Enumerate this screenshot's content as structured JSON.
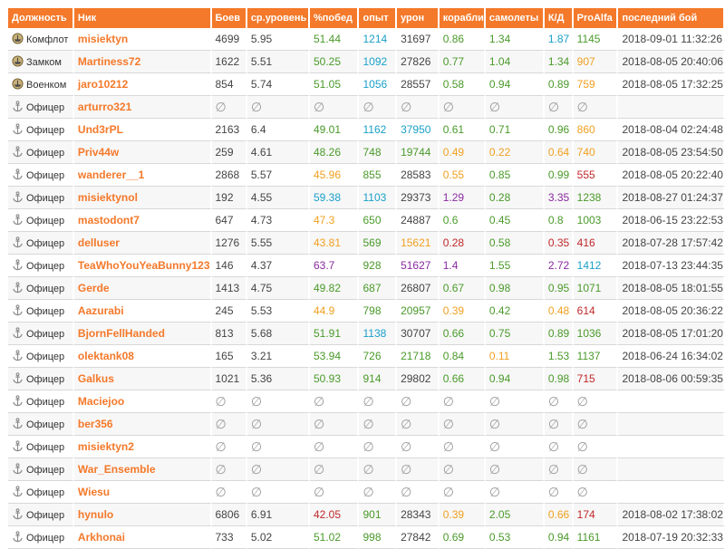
{
  "headers": [
    "Должность",
    "Ник",
    "Боев",
    "ср.уровень",
    "%побед",
    "опыт",
    "урон",
    "корабли",
    "самолеты",
    "К/Д",
    "ProAlfa",
    "последний бой"
  ],
  "empty_symbol": "∅",
  "rows": [
    {
      "role": "Комфлот",
      "icon": "ship-medal-icon",
      "nick": "misiektyn",
      "battles": "4699",
      "level": "5.95",
      "win": "51.44",
      "winc": "g",
      "xp": "1214",
      "xpc": "c",
      "dmg": "31697",
      "dmgc": "d",
      "ships": "0.86",
      "shipsc": "g",
      "planes": "1.34",
      "planesc": "g",
      "kd": "1.87",
      "kdc": "c",
      "pa": "1145",
      "pac": "g",
      "last": "2018-09-01 11:32:26"
    },
    {
      "role": "Замком",
      "icon": "ship-medal-icon",
      "nick": "Martiness72",
      "battles": "1622",
      "level": "5.51",
      "win": "50.25",
      "winc": "g",
      "xp": "1092",
      "xpc": "c",
      "dmg": "27826",
      "dmgc": "d",
      "ships": "0.77",
      "shipsc": "g",
      "planes": "1.04",
      "planesc": "g",
      "kd": "1.34",
      "kdc": "g",
      "pa": "907",
      "pac": "o",
      "last": "2018-08-05 20:40:06"
    },
    {
      "role": "Военком",
      "icon": "ship-medal-icon",
      "nick": "jaro10212",
      "battles": "854",
      "level": "5.74",
      "win": "51.05",
      "winc": "g",
      "xp": "1056",
      "xpc": "c",
      "dmg": "28557",
      "dmgc": "d",
      "ships": "0.58",
      "shipsc": "g",
      "planes": "0.94",
      "planesc": "g",
      "kd": "0.89",
      "kdc": "g",
      "pa": "759",
      "pac": "o",
      "last": "2018-08-05 17:32:25"
    },
    {
      "role": "Офицер",
      "icon": "anchor-icon",
      "nick": "arturro321",
      "empty": true
    },
    {
      "role": "Офицер",
      "icon": "anchor-icon",
      "nick": "Und3rPL",
      "battles": "2163",
      "level": "6.4",
      "win": "49.01",
      "winc": "g",
      "xp": "1162",
      "xpc": "c",
      "dmg": "37950",
      "dmgc": "c",
      "ships": "0.61",
      "shipsc": "g",
      "planes": "0.71",
      "planesc": "g",
      "kd": "0.96",
      "kdc": "g",
      "pa": "860",
      "pac": "o",
      "last": "2018-08-04 02:24:48"
    },
    {
      "role": "Офицер",
      "icon": "anchor-icon",
      "nick": "Priv44w",
      "battles": "259",
      "level": "4.61",
      "win": "48.26",
      "winc": "g",
      "xp": "748",
      "xpc": "g",
      "dmg": "19744",
      "dmgc": "g",
      "ships": "0.49",
      "shipsc": "o",
      "planes": "0.22",
      "planesc": "o",
      "kd": "0.64",
      "kdc": "o",
      "pa": "740",
      "pac": "o",
      "last": "2018-08-05 23:54:50"
    },
    {
      "role": "Офицер",
      "icon": "anchor-icon",
      "nick": "wanderer__1",
      "battles": "2868",
      "level": "5.57",
      "win": "45.96",
      "winc": "o",
      "xp": "855",
      "xpc": "g",
      "dmg": "28583",
      "dmgc": "d",
      "ships": "0.55",
      "shipsc": "o",
      "planes": "0.85",
      "planesc": "g",
      "kd": "0.99",
      "kdc": "g",
      "pa": "555",
      "pac": "r",
      "last": "2018-08-05 20:22:40"
    },
    {
      "role": "Офицер",
      "icon": "anchor-icon",
      "nick": "misiektynol",
      "battles": "192",
      "level": "4.55",
      "win": "59.38",
      "winc": "c",
      "xp": "1103",
      "xpc": "c",
      "dmg": "29373",
      "dmgc": "d",
      "ships": "1.29",
      "shipsc": "p",
      "planes": "0.28",
      "planesc": "g",
      "kd": "3.35",
      "kdc": "p",
      "pa": "1238",
      "pac": "g",
      "last": "2018-08-27 01:24:37"
    },
    {
      "role": "Офицер",
      "icon": "anchor-icon",
      "nick": "mastodont7",
      "battles": "647",
      "level": "4.73",
      "win": "47.3",
      "winc": "o",
      "xp": "650",
      "xpc": "g",
      "dmg": "24887",
      "dmgc": "d",
      "ships": "0.6",
      "shipsc": "g",
      "planes": "0.45",
      "planesc": "g",
      "kd": "0.8",
      "kdc": "g",
      "pa": "1003",
      "pac": "g",
      "last": "2018-06-15 23:22:53"
    },
    {
      "role": "Офицер",
      "icon": "anchor-icon",
      "nick": "delluser",
      "battles": "1276",
      "level": "5.55",
      "win": "43.81",
      "winc": "o",
      "xp": "569",
      "xpc": "g",
      "dmg": "15621",
      "dmgc": "o",
      "ships": "0.28",
      "shipsc": "r",
      "planes": "0.58",
      "planesc": "g",
      "kd": "0.35",
      "kdc": "r",
      "pa": "416",
      "pac": "r",
      "last": "2018-07-28 17:57:42"
    },
    {
      "role": "Офицер",
      "icon": "anchor-icon",
      "nick": "TeaWhoYouYeaBunny123",
      "battles": "146",
      "level": "4.37",
      "win": "63.7",
      "winc": "p",
      "xp": "928",
      "xpc": "g",
      "dmg": "51627",
      "dmgc": "p",
      "ships": "1.4",
      "shipsc": "p",
      "planes": "1.55",
      "planesc": "g",
      "kd": "2.72",
      "kdc": "p",
      "pa": "1412",
      "pac": "c",
      "last": "2018-07-13 23:44:35"
    },
    {
      "role": "Офицер",
      "icon": "anchor-icon",
      "nick": "Gerde",
      "battles": "1413",
      "level": "4.75",
      "win": "49.82",
      "winc": "g",
      "xp": "687",
      "xpc": "g",
      "dmg": "26807",
      "dmgc": "d",
      "ships": "0.67",
      "shipsc": "g",
      "planes": "0.98",
      "planesc": "g",
      "kd": "0.95",
      "kdc": "g",
      "pa": "1071",
      "pac": "g",
      "last": "2018-08-05 18:01:55"
    },
    {
      "role": "Офицер",
      "icon": "anchor-icon",
      "nick": "Aazurabi",
      "battles": "245",
      "level": "5.53",
      "win": "44.9",
      "winc": "o",
      "xp": "798",
      "xpc": "g",
      "dmg": "20957",
      "dmgc": "g",
      "ships": "0.39",
      "shipsc": "o",
      "planes": "0.42",
      "planesc": "g",
      "kd": "0.48",
      "kdc": "o",
      "pa": "614",
      "pac": "r",
      "last": "2018-08-05 20:36:22"
    },
    {
      "role": "Офицер",
      "icon": "anchor-icon",
      "nick": "BjornFellHanded",
      "battles": "813",
      "level": "5.68",
      "win": "51.91",
      "winc": "g",
      "xp": "1138",
      "xpc": "c",
      "dmg": "30707",
      "dmgc": "d",
      "ships": "0.66",
      "shipsc": "g",
      "planes": "0.75",
      "planesc": "g",
      "kd": "0.89",
      "kdc": "g",
      "pa": "1036",
      "pac": "g",
      "last": "2018-08-05 17:01:20"
    },
    {
      "role": "Офицер",
      "icon": "anchor-icon",
      "nick": "olektank08",
      "battles": "165",
      "level": "3.21",
      "win": "53.94",
      "winc": "g",
      "xp": "726",
      "xpc": "g",
      "dmg": "21718",
      "dmgc": "g",
      "ships": "0.84",
      "shipsc": "g",
      "planes": "0.11",
      "planesc": "o",
      "kd": "1.53",
      "kdc": "g",
      "pa": "1137",
      "pac": "g",
      "last": "2018-06-24 16:34:02"
    },
    {
      "role": "Офицер",
      "icon": "anchor-icon",
      "nick": "Galkus",
      "battles": "1021",
      "level": "5.36",
      "win": "50.93",
      "winc": "g",
      "xp": "914",
      "xpc": "g",
      "dmg": "29802",
      "dmgc": "d",
      "ships": "0.66",
      "shipsc": "g",
      "planes": "0.94",
      "planesc": "g",
      "kd": "0.98",
      "kdc": "g",
      "pa": "715",
      "pac": "r",
      "last": "2018-08-06 00:59:35"
    },
    {
      "role": "Офицер",
      "icon": "anchor-icon",
      "nick": "Maciejoo",
      "empty": true
    },
    {
      "role": "Офицер",
      "icon": "anchor-icon",
      "nick": "ber356",
      "empty": true
    },
    {
      "role": "Офицер",
      "icon": "anchor-icon",
      "nick": "misiektyn2",
      "empty": true
    },
    {
      "role": "Офицер",
      "icon": "anchor-icon",
      "nick": "War_Ensemble",
      "empty": true
    },
    {
      "role": "Офицер",
      "icon": "anchor-icon",
      "nick": "Wiesu",
      "empty": true
    },
    {
      "role": "Офицер",
      "icon": "anchor-icon",
      "nick": "hynulo",
      "battles": "6806",
      "level": "6.91",
      "win": "42.05",
      "winc": "r",
      "xp": "901",
      "xpc": "g",
      "dmg": "28343",
      "dmgc": "d",
      "ships": "0.39",
      "shipsc": "o",
      "planes": "2.05",
      "planesc": "g",
      "kd": "0.66",
      "kdc": "o",
      "pa": "174",
      "pac": "r",
      "last": "2018-08-02 17:38:02"
    },
    {
      "role": "Офицер",
      "icon": "anchor-icon",
      "nick": "Arkhonai",
      "battles": "733",
      "level": "5.02",
      "win": "51.02",
      "winc": "g",
      "xp": "998",
      "xpc": "g",
      "dmg": "27842",
      "dmgc": "d",
      "ships": "0.69",
      "shipsc": "g",
      "planes": "0.53",
      "planesc": "g",
      "kd": "0.94",
      "kdc": "g",
      "pa": "1161",
      "pac": "g",
      "last": "2018-07-19 20:32:33"
    }
  ]
}
